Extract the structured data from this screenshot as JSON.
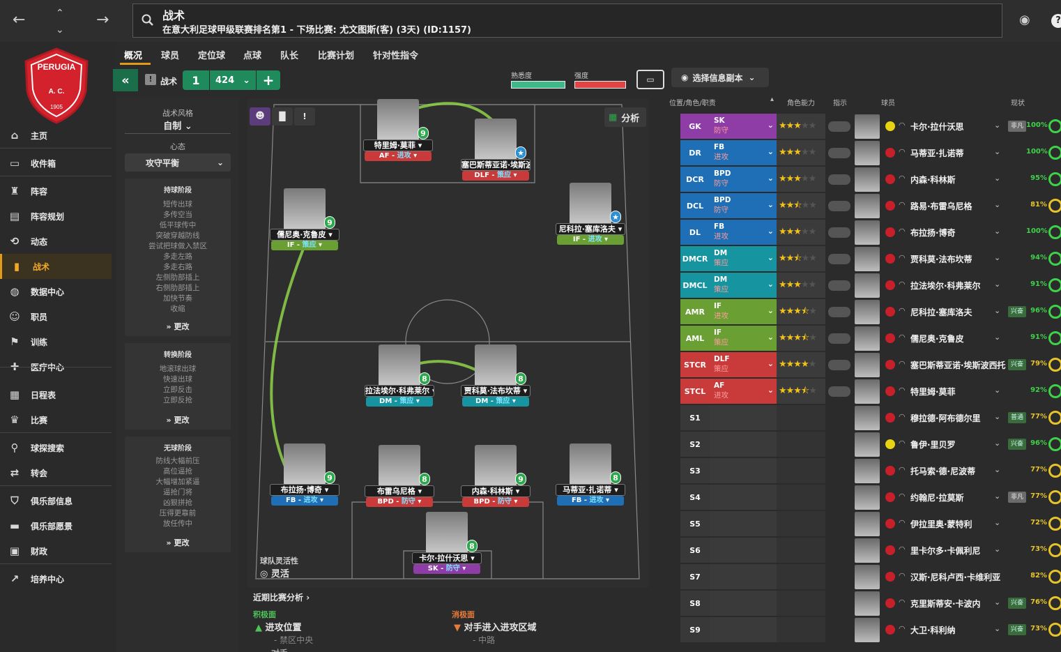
{
  "header": {
    "title": "战术",
    "subtitle": "在意大利足球甲级联赛排名第1 - 下场比赛: 尤文图斯(客) (3天) (ID:1157)"
  },
  "club": {
    "crest_text": "PERUGIA",
    "crest_letters": "A.   C.",
    "crest_year": "1905"
  },
  "sidebar": {
    "items": [
      {
        "label": "主页",
        "icon": "home-icon"
      },
      {
        "label": "收件箱",
        "icon": "inbox-icon"
      },
      {
        "label": "阵容",
        "icon": "shirt-icon"
      },
      {
        "label": "阵容规划",
        "icon": "clipboard-icon"
      },
      {
        "label": "动态",
        "icon": "dynamics-icon"
      },
      {
        "label": "战术",
        "icon": "tactics-icon",
        "active": true
      },
      {
        "label": "数据中心",
        "icon": "data-icon"
      },
      {
        "label": "职员",
        "icon": "staff-icon"
      },
      {
        "label": "训练",
        "icon": "training-icon"
      },
      {
        "label": "医疗中心",
        "icon": "medical-icon"
      },
      {
        "label": "日程表",
        "icon": "calendar-icon"
      },
      {
        "label": "比赛",
        "icon": "trophy-icon"
      },
      {
        "label": "球探搜索",
        "icon": "search-icon"
      },
      {
        "label": "转会",
        "icon": "transfer-icon"
      },
      {
        "label": "俱乐部信息",
        "icon": "shield-icon"
      },
      {
        "label": "俱乐部愿景",
        "icon": "briefcase-icon"
      },
      {
        "label": "财政",
        "icon": "money-icon"
      },
      {
        "label": "培养中心",
        "icon": "growth-icon"
      }
    ]
  },
  "tabs": [
    "概况",
    "球员",
    "定位球",
    "点球",
    "队长",
    "比赛计划",
    "针对性指令"
  ],
  "toolbar": {
    "tactic_label": "战术",
    "slot": "1",
    "formation": "424",
    "familiarity": "熟悉度",
    "intensity": "强度",
    "view_button": "选择信息副本",
    "analysis": "分析"
  },
  "left": {
    "style_label": "战术风格",
    "style_value": "自制",
    "mentality_label": "心态",
    "mentality_value": "攻守平衡",
    "possession": {
      "title": "持球阶段",
      "items": [
        "短传出球",
        "多传空当",
        "低平球传中",
        "突破穿越防线",
        "尝试把球做入禁区",
        "多走左路",
        "多走右路",
        "左侧肋部插上",
        "右侧肋部插上",
        "加快节奏",
        "收缩"
      ],
      "more": "更改"
    },
    "transition": {
      "title": "转换阶段",
      "items": [
        "地滚球出球",
        "快速出球",
        "立即反击",
        "立即反抢"
      ],
      "more": "更改"
    },
    "defense": {
      "title": "无球阶段",
      "items": [
        "防线大幅前压",
        "高位逼抢",
        "大幅增加紧逼",
        "逼抢门将",
        "凶狠拼抢",
        "压得更靠前",
        "放任传中"
      ],
      "more": "更改"
    }
  },
  "pitch_players": [
    {
      "name": "特里姆·莫菲",
      "role": "AF",
      "duty": "进攻",
      "num": "9",
      "color": "red"
    },
    {
      "name": "塞巴斯蒂亚诺·埃斯波西托",
      "role": "DLF",
      "duty": "策应",
      "num": "",
      "color": "red"
    },
    {
      "name": "儒尼奥·克鲁皮",
      "role": "IF",
      "duty": "策应",
      "num": "9",
      "color": "green"
    },
    {
      "name": "尼科拉·塞库洛夫",
      "role": "IF",
      "duty": "进攻",
      "num": "",
      "color": "green"
    },
    {
      "name": "拉法埃尔·科弗莱尔",
      "role": "DM",
      "duty": "策应",
      "num": "8",
      "color": "teal"
    },
    {
      "name": "贾科莫·法布坎蒂",
      "role": "DM",
      "duty": "策应",
      "num": "8",
      "color": "teal"
    },
    {
      "name": "布拉扬·博奇",
      "role": "FB",
      "duty": "进攻",
      "num": "9",
      "color": "blue"
    },
    {
      "name": "布雷乌尼格",
      "role": "BPD",
      "duty": "防守",
      "num": "8",
      "color": "red"
    },
    {
      "name": "内森·科林斯",
      "role": "BPD",
      "duty": "防守",
      "num": "9",
      "color": "red"
    },
    {
      "name": "马蒂亚·扎诺蒂",
      "role": "FB",
      "duty": "进攻",
      "num": "8",
      "color": "blue"
    },
    {
      "name": "卡尔·拉什沃思",
      "role": "SK",
      "duty": "防守",
      "num": "8",
      "color": "purple"
    }
  ],
  "flex": {
    "label": "球队灵活性",
    "value": "灵活"
  },
  "analysis": {
    "title": "近期比赛分析",
    "pos_title": "积极面",
    "pos_item": "进攻位置",
    "pos_sub": "- 禁区中央",
    "neg_title": "消极面",
    "neg_item": "对手进入进攻区域",
    "neg_sub": "- 中路",
    "cut": "对手"
  },
  "table": {
    "headers": [
      "位置/角色/职责",
      "角色能力",
      "指示",
      "球员",
      "现状"
    ],
    "rows": [
      {
        "pos": "GK",
        "role": "SK",
        "duty": "防守",
        "stars": "★★★",
        "empty": "★★",
        "name": "卡尔·拉什沃思",
        "badge": "非凡",
        "pct": "100%",
        "kit": "y"
      },
      {
        "pos": "DR",
        "role": "FB",
        "duty": "进攻",
        "stars": "★★★",
        "empty": "★★",
        "name": "马蒂亚·扎诺蒂",
        "badge": "",
        "pct": "100%",
        "kit": ""
      },
      {
        "pos": "DCR",
        "role": "BPD",
        "duty": "防守",
        "stars": "★★★",
        "empty": "★★",
        "name": "内森·科林斯",
        "badge": "",
        "pct": "95%",
        "kit": ""
      },
      {
        "pos": "DCL",
        "role": "BPD",
        "duty": "防守",
        "stars": "★★⯪",
        "empty": "★★",
        "name": "路易·布雷乌尼格",
        "badge": "",
        "pct": "81%",
        "kit": ""
      },
      {
        "pos": "DL",
        "role": "FB",
        "duty": "进攻",
        "stars": "★★★",
        "empty": "★★",
        "name": "布拉扬·博奇",
        "badge": "",
        "pct": "100%",
        "kit": ""
      },
      {
        "pos": "DMCR",
        "role": "DM",
        "duty": "策应",
        "stars": "★★⯪",
        "empty": "★★",
        "name": "贾科莫·法布坎蒂",
        "badge": "",
        "pct": "94%",
        "kit": ""
      },
      {
        "pos": "DMCL",
        "role": "DM",
        "duty": "策应",
        "stars": "★★★",
        "empty": "★★",
        "name": "拉法埃尔·科弗莱尔",
        "badge": "",
        "pct": "91%",
        "kit": ""
      },
      {
        "pos": "AMR",
        "role": "IF",
        "duty": "进攻",
        "stars": "★★★⯪",
        "empty": "★",
        "name": "尼科拉·塞库洛夫",
        "badge": "兴奋",
        "pct": "96%",
        "kit": ""
      },
      {
        "pos": "AML",
        "role": "IF",
        "duty": "策应",
        "stars": "★★★⯪",
        "empty": "★",
        "name": "儒尼奥·克鲁皮",
        "badge": "",
        "pct": "91%",
        "kit": ""
      },
      {
        "pos": "STCR",
        "role": "DLF",
        "duty": "策应",
        "stars": "★★★★",
        "empty": "★",
        "name": "塞巴斯蒂亚诺·埃斯波西托",
        "badge": "兴奋",
        "pct": "79%",
        "kit": ""
      },
      {
        "pos": "STCL",
        "role": "AF",
        "duty": "进攻",
        "stars": "★★★⯪",
        "empty": "★",
        "name": "特里姆·莫菲",
        "badge": "",
        "pct": "92%",
        "kit": ""
      },
      {
        "pos": "S1",
        "role": "",
        "duty": "",
        "stars": "",
        "empty": "",
        "name": "穆拉德·阿布德尔里",
        "badge": "普通",
        "pct": "77%",
        "kit": ""
      },
      {
        "pos": "S2",
        "role": "",
        "duty": "",
        "stars": "",
        "empty": "",
        "name": "鲁伊·里贝罗",
        "badge": "兴奋",
        "pct": "96%",
        "kit": "y"
      },
      {
        "pos": "S3",
        "role": "",
        "duty": "",
        "stars": "",
        "empty": "",
        "name": "托马索·德·尼波蒂",
        "badge": "",
        "pct": "77%",
        "kit": ""
      },
      {
        "pos": "S4",
        "role": "",
        "duty": "",
        "stars": "",
        "empty": "",
        "name": "约翰尼·拉莫斯",
        "badge": "非凡",
        "pct": "77%",
        "kit": ""
      },
      {
        "pos": "S5",
        "role": "",
        "duty": "",
        "stars": "",
        "empty": "",
        "name": "伊拉里奥·蒙特利",
        "badge": "",
        "pct": "72%",
        "kit": ""
      },
      {
        "pos": "S6",
        "role": "",
        "duty": "",
        "stars": "",
        "empty": "",
        "name": "里卡尔多·卡佩利尼",
        "badge": "",
        "pct": "73%",
        "kit": ""
      },
      {
        "pos": "S7",
        "role": "",
        "duty": "",
        "stars": "",
        "empty": "",
        "name": "汉斯·尼科卢西·卡维利亚",
        "badge": "",
        "pct": "82%",
        "kit": ""
      },
      {
        "pos": "S8",
        "role": "",
        "duty": "",
        "stars": "",
        "empty": "",
        "name": "克里斯蒂安·卡波内",
        "badge": "兴奋",
        "pct": "76%",
        "kit": ""
      },
      {
        "pos": "S9",
        "role": "",
        "duty": "",
        "stars": "",
        "empty": "",
        "name": "大卫·科利纳",
        "badge": "兴奋",
        "pct": "73%",
        "kit": ""
      }
    ]
  },
  "colors": {
    "accent": "#e09b18",
    "green": "#1f8a5c",
    "gk": "#8e3ca6",
    "def": "#1e6fb5",
    "dm": "#1694a0",
    "am": "#6aa033",
    "st": "#c93a3a"
  }
}
